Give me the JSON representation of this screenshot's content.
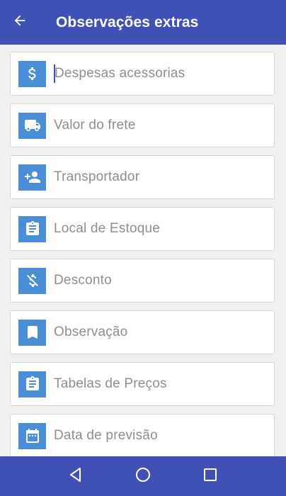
{
  "header": {
    "title": "Observações extras",
    "back_icon": "arrow-left-icon"
  },
  "fields": [
    {
      "label": "Despesas acessorias",
      "icon": "dollar-icon",
      "focused": true
    },
    {
      "label": "Valor do frete",
      "icon": "truck-icon",
      "focused": false
    },
    {
      "label": "Transportador",
      "icon": "person-add-icon",
      "focused": false
    },
    {
      "label": "Local de Estoque",
      "icon": "clipboard-icon",
      "focused": false
    },
    {
      "label": "Desconto",
      "icon": "money-off-icon",
      "focused": false
    },
    {
      "label": "Observação",
      "icon": "bookmark-icon",
      "focused": false
    },
    {
      "label": "Tabelas de Preços",
      "icon": "clipboard-icon",
      "focused": false
    },
    {
      "label": "Data de previsão",
      "icon": "calendar-icon",
      "focused": false
    }
  ],
  "navigation": {
    "back_icon": "nav-back-icon",
    "home_icon": "nav-home-icon",
    "recents_icon": "nav-recents-icon"
  },
  "colors": {
    "primary": "#3f51b5",
    "icon_tile": "#4a8fd6",
    "hint_text": "#8e8e8e"
  }
}
